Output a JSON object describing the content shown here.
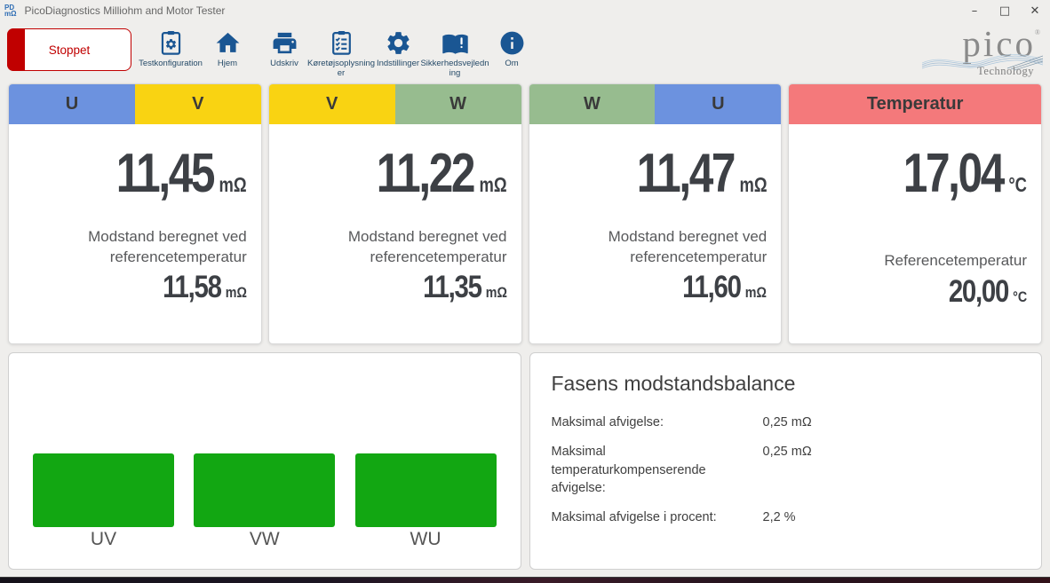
{
  "window": {
    "title": "PicoDiagnostics Milliohm and Motor Tester",
    "app_icon": {
      "line1": "PD",
      "line2": "mΩ"
    },
    "controls": [
      {
        "name": "minimize",
        "glyph": "–"
      },
      {
        "name": "maximize",
        "glyph": "□"
      },
      {
        "name": "close",
        "glyph": "✕"
      }
    ]
  },
  "toolbar": {
    "stop_button_label": "Stoppet",
    "buttons": [
      {
        "label": "Testkonfiguration",
        "icon": "test-config-icon"
      },
      {
        "label": "Hjem",
        "icon": "home-icon"
      },
      {
        "label": "Udskriv",
        "icon": "print-icon"
      },
      {
        "label": "Køretøjsoplysninger",
        "icon": "vehicle-info-icon"
      },
      {
        "label": "Indstillinger",
        "icon": "settings-icon"
      },
      {
        "label": "Sikkerhedsvejledning",
        "icon": "safety-guide-icon"
      },
      {
        "label": "Om",
        "icon": "about-icon"
      }
    ],
    "logo": {
      "brand": "pico",
      "registered": "®",
      "sub": "Technology"
    }
  },
  "colors": {
    "phase_u_blue": "#6C92DF",
    "phase_v_yellow": "#F9D312",
    "phase_w_green": "#97BC8F",
    "temperature_red": "#F4797B",
    "bar_green": "#12A712",
    "accent_blue": "#1A5693",
    "stop_red": "#C00000"
  },
  "cards": [
    {
      "header": [
        {
          "label": "U",
          "color": "#6C92DF"
        },
        {
          "label": "V",
          "color": "#F9D312"
        }
      ],
      "value": "11,45",
      "unit": "mΩ",
      "caption": "Modstand beregnet ved referencetemperatur",
      "ref_value": "11,58",
      "ref_unit": "mΩ"
    },
    {
      "header": [
        {
          "label": "V",
          "color": "#F9D312"
        },
        {
          "label": "W",
          "color": "#97BC8F"
        }
      ],
      "value": "11,22",
      "unit": "mΩ",
      "caption": "Modstand beregnet ved referencetemperatur",
      "ref_value": "11,35",
      "ref_unit": "mΩ"
    },
    {
      "header": [
        {
          "label": "W",
          "color": "#97BC8F"
        },
        {
          "label": "U",
          "color": "#6C92DF"
        }
      ],
      "value": "11,47",
      "unit": "mΩ",
      "caption": "Modstand beregnet ved referencetemperatur",
      "ref_value": "11,60",
      "ref_unit": "mΩ"
    },
    {
      "header": [
        {
          "label": "Temperatur",
          "color": "#F4797B"
        }
      ],
      "value": "17,04",
      "unit": "°C",
      "caption": "Referencetemperatur",
      "ref_value": "20,00",
      "ref_unit": "°C"
    }
  ],
  "chart_data": {
    "type": "bar",
    "categories": [
      "UV",
      "VW",
      "WU"
    ],
    "values": [
      1,
      1,
      1
    ],
    "bar_color": "#12A712",
    "title": "",
    "xlabel": "",
    "ylabel": "",
    "note": "Three equal-height green status bars; no axes, gridlines or value labels shown"
  },
  "balance_panel": {
    "title": "Fasens modstandsbalance",
    "rows": [
      {
        "label": "Maksimal afvigelse:",
        "value": "0,25 mΩ"
      },
      {
        "label": "Maksimal temperaturkompenserende afvigelse:",
        "value": "0,25 mΩ"
      },
      {
        "label": "Maksimal afvigelse i procent:",
        "value": "2,2 %"
      }
    ]
  }
}
